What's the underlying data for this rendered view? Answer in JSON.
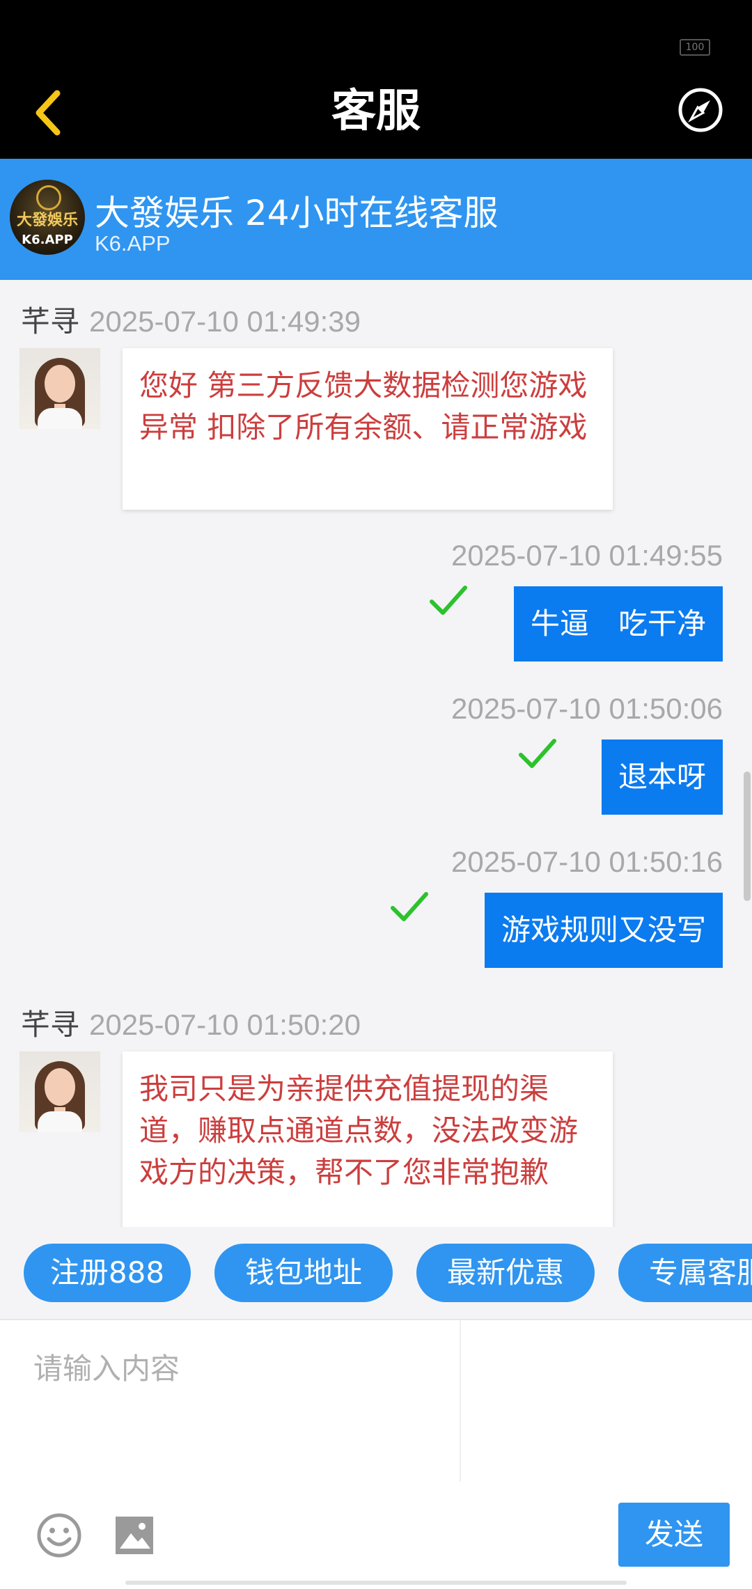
{
  "status_bar": {
    "battery": "100"
  },
  "nav": {
    "title": "客服",
    "back_icon": "chevron-left-icon",
    "right_icon": "compass-icon",
    "accent": "#f5c518"
  },
  "service": {
    "logo_text": "大發娛乐",
    "logo_sub": "K6.APP",
    "title": "大發娱乐 24小时在线客服",
    "subtitle": "K6.APP",
    "color": "#2f95f0"
  },
  "messages": [
    {
      "from": "agent",
      "name": "芊寻",
      "time": "2025-07-10 01:49:39",
      "text": "您好 第三方反馈大数据检测您游戏异常 扣除了所有余额、请正常游戏"
    },
    {
      "from": "me",
      "time": "2025-07-10 01:49:55",
      "text": "牛逼　吃干净",
      "status": "sent"
    },
    {
      "from": "me",
      "time": "2025-07-10 01:50:06",
      "text": "退本呀",
      "status": "sent"
    },
    {
      "from": "me",
      "time": "2025-07-10 01:50:16",
      "text": "游戏规则又没写",
      "status": "sent"
    },
    {
      "from": "agent",
      "name": "芊寻",
      "time": "2025-07-10 01:50:20",
      "text": "我司只是为亲提供充值提现的渠道，赚取点通道点数，没法改变游戏方的决策，帮不了您非常抱歉"
    }
  ],
  "quick_replies": [
    "注册888",
    "钱包地址",
    "最新优惠",
    "专属客服"
  ],
  "input": {
    "placeholder": "请输入内容",
    "value": ""
  },
  "toolbar": {
    "emoji_icon": "emoji-icon",
    "image_icon": "image-icon",
    "send_label": "发送"
  }
}
